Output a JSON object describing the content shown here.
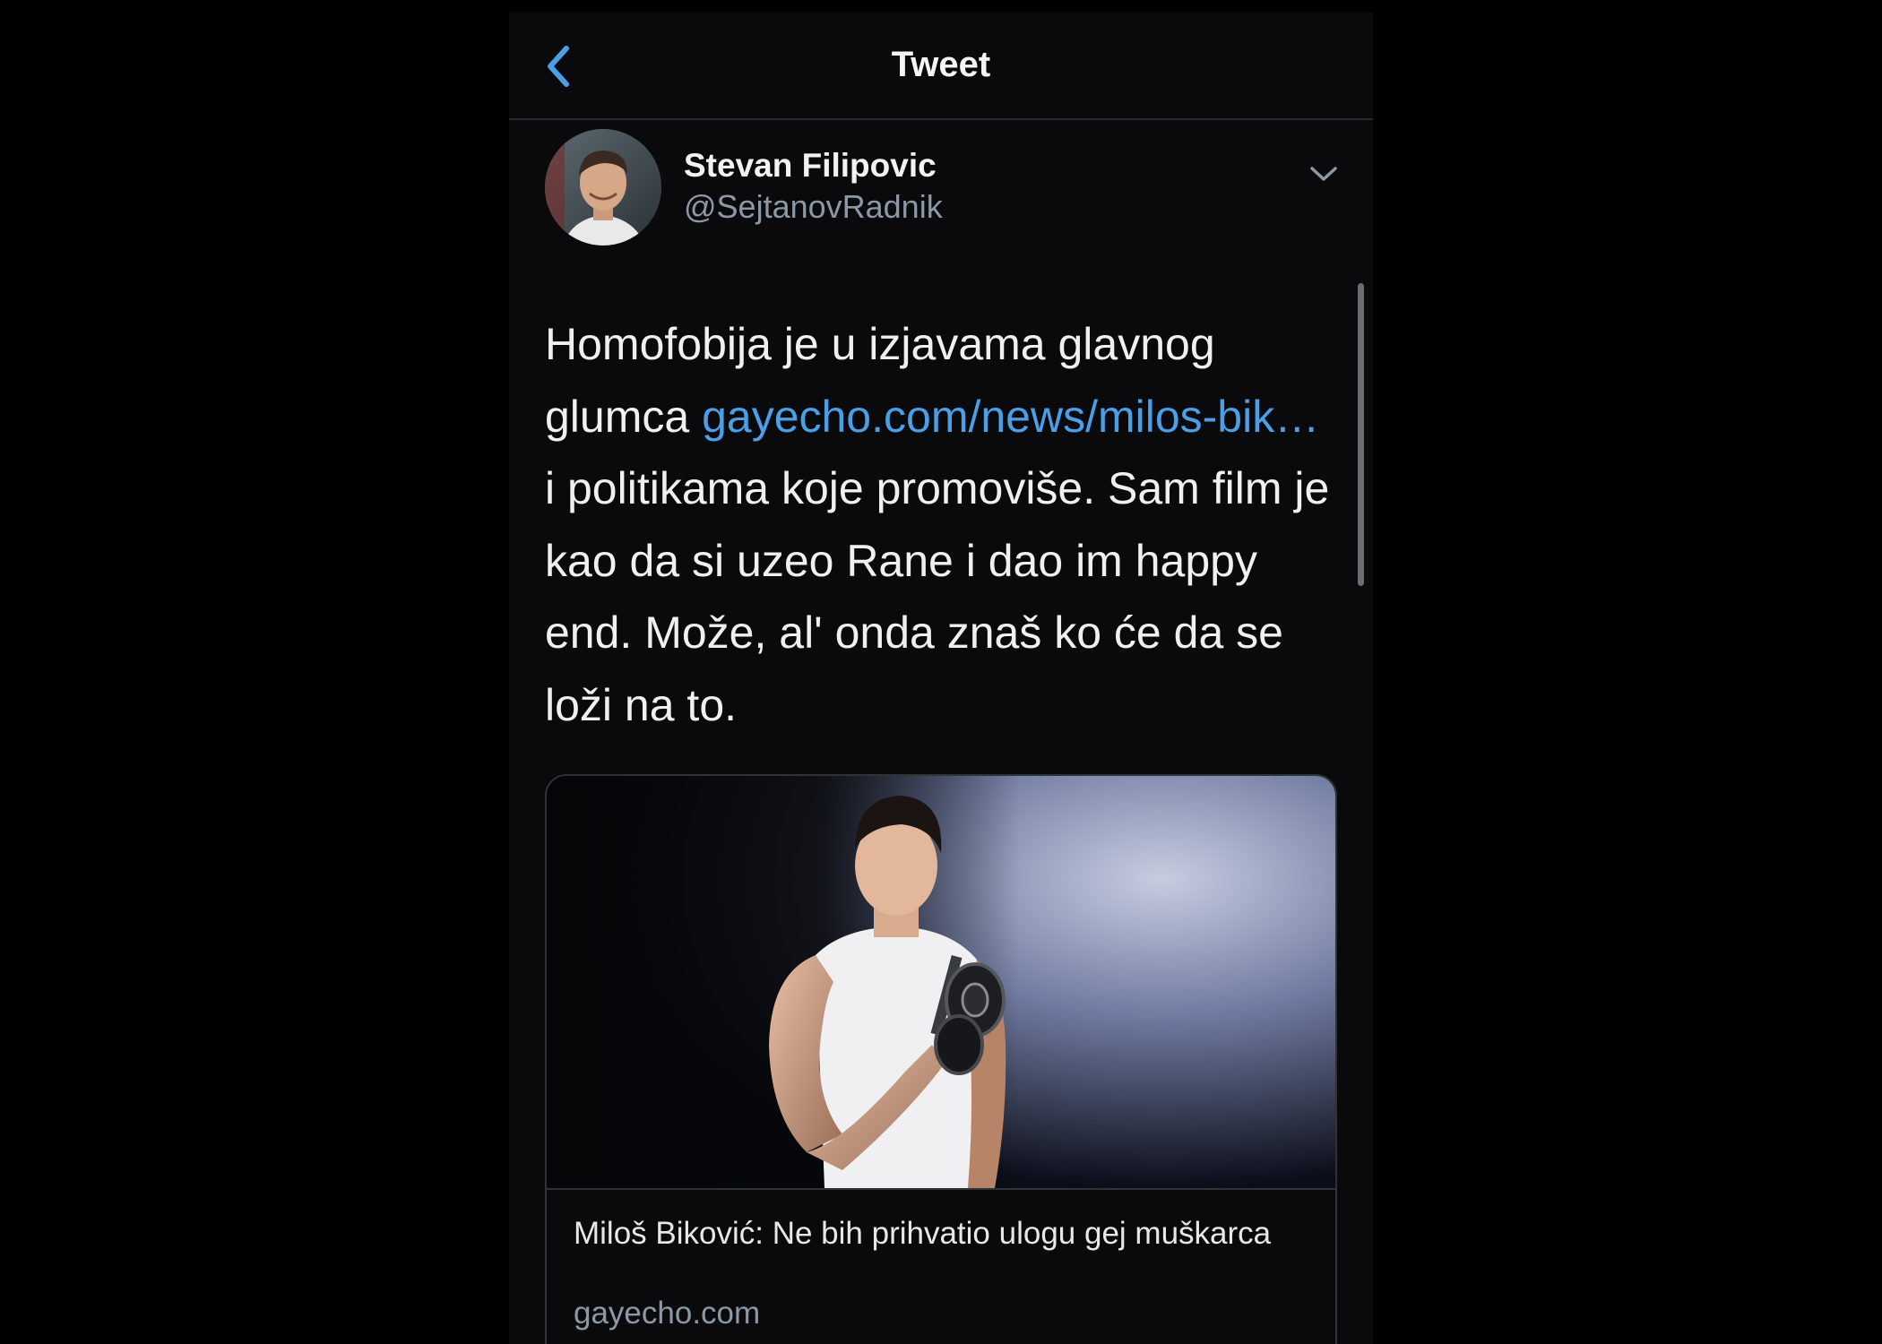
{
  "header": {
    "title": "Tweet"
  },
  "author": {
    "name": "Stevan Filipovic",
    "handle": "@SejtanovRadnik"
  },
  "tweet": {
    "text_part1": "Homofobija je u izjavama glavnog glumca ",
    "link_text": "gayecho.com/news/milos-bik…",
    "text_part2": " i politikama koje promoviše. Sam film je kao da si uzeo Rane i dao im happy end. Može, al' onda znaš ko će da se loži na to."
  },
  "link_card": {
    "title": "Miloš Biković: Ne bih prihvatio ulogu gej muškarca",
    "domain": "gayecho.com"
  },
  "colors": {
    "background": "#000000",
    "link": "#4a9fe6",
    "secondary_text": "#8b98a5"
  }
}
